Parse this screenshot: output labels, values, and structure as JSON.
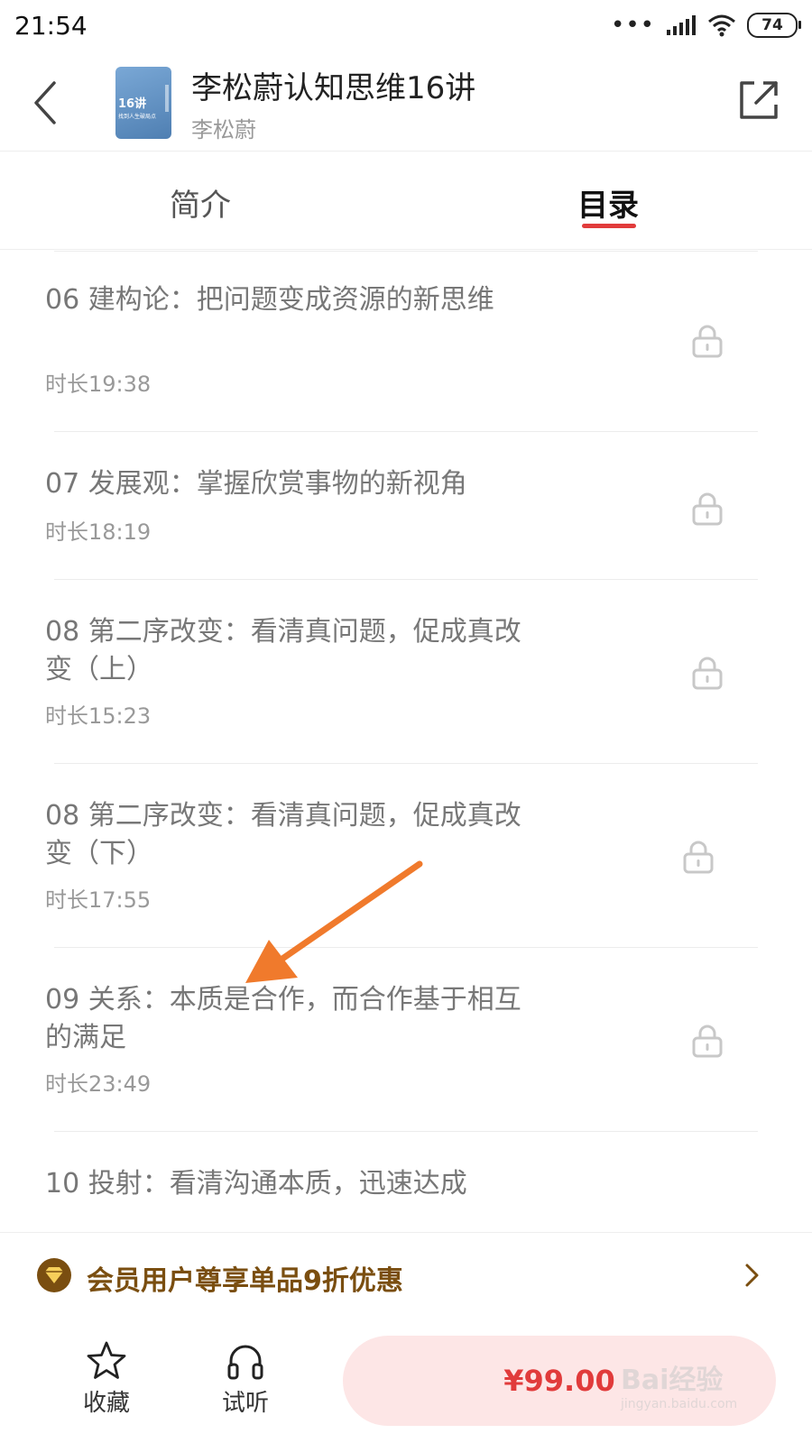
{
  "status_bar": {
    "time": "21:54",
    "battery": "74",
    "dots": "•••"
  },
  "header": {
    "title": "李松蔚认知思维16讲",
    "author": "李松蔚",
    "cover_text_1": "16讲",
    "cover_text_2": "找到人生破局点"
  },
  "tabs": [
    {
      "label": "简介",
      "active": false
    },
    {
      "label": "目录",
      "active": true
    }
  ],
  "lessons": [
    {
      "title": "06 建构论：把问题变成资源的新思维",
      "duration": "时长19:38",
      "locked": true
    },
    {
      "title": "07 发展观：掌握欣赏事物的新视角",
      "duration": "时长18:19",
      "locked": true
    },
    {
      "title": "08 第二序改变：看清真问题，促成真改变（上）",
      "duration": "时长15:23",
      "locked": true
    },
    {
      "title": "08 第二序改变：看清真问题，促成真改变（下）",
      "duration": "时长17:55",
      "locked": true
    },
    {
      "title": "09 关系：本质是合作，而合作基于相互的满足",
      "duration": "时长23:49",
      "locked": true
    },
    {
      "title": "10 投射：看清沟通本质，迅速达成",
      "duration": "",
      "locked": true
    }
  ],
  "member_banner": {
    "text": "会员用户尊享单品9折优惠"
  },
  "bottom_bar": {
    "favorite_label": "收藏",
    "trial_label": "试听",
    "price": "¥99.00"
  },
  "watermark": {
    "main": "Bai经验",
    "sub": "jingyan.baidu.com"
  },
  "colors": {
    "accent_red": "#e13b3b",
    "member_gold": "#7a4e10",
    "arrow_orange": "#f07a2c"
  }
}
